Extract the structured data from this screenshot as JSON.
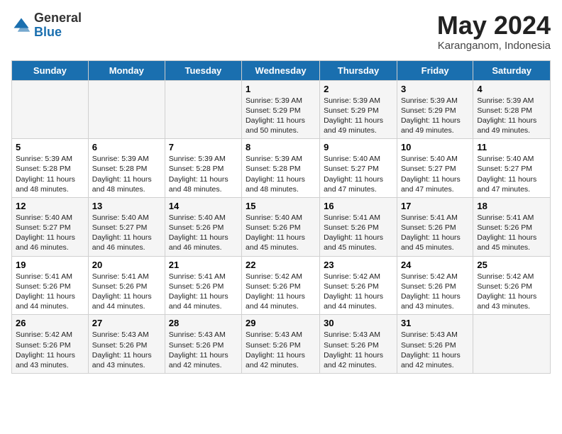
{
  "header": {
    "logo_general": "General",
    "logo_blue": "Blue",
    "title": "May 2024",
    "subtitle": "Karanganom, Indonesia"
  },
  "columns": [
    "Sunday",
    "Monday",
    "Tuesday",
    "Wednesday",
    "Thursday",
    "Friday",
    "Saturday"
  ],
  "rows": [
    [
      {
        "day": "",
        "info": ""
      },
      {
        "day": "",
        "info": ""
      },
      {
        "day": "",
        "info": ""
      },
      {
        "day": "1",
        "info": "Sunrise: 5:39 AM\nSunset: 5:29 PM\nDaylight: 11 hours and 50 minutes."
      },
      {
        "day": "2",
        "info": "Sunrise: 5:39 AM\nSunset: 5:29 PM\nDaylight: 11 hours and 49 minutes."
      },
      {
        "day": "3",
        "info": "Sunrise: 5:39 AM\nSunset: 5:29 PM\nDaylight: 11 hours and 49 minutes."
      },
      {
        "day": "4",
        "info": "Sunrise: 5:39 AM\nSunset: 5:28 PM\nDaylight: 11 hours and 49 minutes."
      }
    ],
    [
      {
        "day": "5",
        "info": "Sunrise: 5:39 AM\nSunset: 5:28 PM\nDaylight: 11 hours and 48 minutes."
      },
      {
        "day": "6",
        "info": "Sunrise: 5:39 AM\nSunset: 5:28 PM\nDaylight: 11 hours and 48 minutes."
      },
      {
        "day": "7",
        "info": "Sunrise: 5:39 AM\nSunset: 5:28 PM\nDaylight: 11 hours and 48 minutes."
      },
      {
        "day": "8",
        "info": "Sunrise: 5:39 AM\nSunset: 5:28 PM\nDaylight: 11 hours and 48 minutes."
      },
      {
        "day": "9",
        "info": "Sunrise: 5:40 AM\nSunset: 5:27 PM\nDaylight: 11 hours and 47 minutes."
      },
      {
        "day": "10",
        "info": "Sunrise: 5:40 AM\nSunset: 5:27 PM\nDaylight: 11 hours and 47 minutes."
      },
      {
        "day": "11",
        "info": "Sunrise: 5:40 AM\nSunset: 5:27 PM\nDaylight: 11 hours and 47 minutes."
      }
    ],
    [
      {
        "day": "12",
        "info": "Sunrise: 5:40 AM\nSunset: 5:27 PM\nDaylight: 11 hours and 46 minutes."
      },
      {
        "day": "13",
        "info": "Sunrise: 5:40 AM\nSunset: 5:27 PM\nDaylight: 11 hours and 46 minutes."
      },
      {
        "day": "14",
        "info": "Sunrise: 5:40 AM\nSunset: 5:26 PM\nDaylight: 11 hours and 46 minutes."
      },
      {
        "day": "15",
        "info": "Sunrise: 5:40 AM\nSunset: 5:26 PM\nDaylight: 11 hours and 45 minutes."
      },
      {
        "day": "16",
        "info": "Sunrise: 5:41 AM\nSunset: 5:26 PM\nDaylight: 11 hours and 45 minutes."
      },
      {
        "day": "17",
        "info": "Sunrise: 5:41 AM\nSunset: 5:26 PM\nDaylight: 11 hours and 45 minutes."
      },
      {
        "day": "18",
        "info": "Sunrise: 5:41 AM\nSunset: 5:26 PM\nDaylight: 11 hours and 45 minutes."
      }
    ],
    [
      {
        "day": "19",
        "info": "Sunrise: 5:41 AM\nSunset: 5:26 PM\nDaylight: 11 hours and 44 minutes."
      },
      {
        "day": "20",
        "info": "Sunrise: 5:41 AM\nSunset: 5:26 PM\nDaylight: 11 hours and 44 minutes."
      },
      {
        "day": "21",
        "info": "Sunrise: 5:41 AM\nSunset: 5:26 PM\nDaylight: 11 hours and 44 minutes."
      },
      {
        "day": "22",
        "info": "Sunrise: 5:42 AM\nSunset: 5:26 PM\nDaylight: 11 hours and 44 minutes."
      },
      {
        "day": "23",
        "info": "Sunrise: 5:42 AM\nSunset: 5:26 PM\nDaylight: 11 hours and 44 minutes."
      },
      {
        "day": "24",
        "info": "Sunrise: 5:42 AM\nSunset: 5:26 PM\nDaylight: 11 hours and 43 minutes."
      },
      {
        "day": "25",
        "info": "Sunrise: 5:42 AM\nSunset: 5:26 PM\nDaylight: 11 hours and 43 minutes."
      }
    ],
    [
      {
        "day": "26",
        "info": "Sunrise: 5:42 AM\nSunset: 5:26 PM\nDaylight: 11 hours and 43 minutes."
      },
      {
        "day": "27",
        "info": "Sunrise: 5:43 AM\nSunset: 5:26 PM\nDaylight: 11 hours and 43 minutes."
      },
      {
        "day": "28",
        "info": "Sunrise: 5:43 AM\nSunset: 5:26 PM\nDaylight: 11 hours and 42 minutes."
      },
      {
        "day": "29",
        "info": "Sunrise: 5:43 AM\nSunset: 5:26 PM\nDaylight: 11 hours and 42 minutes."
      },
      {
        "day": "30",
        "info": "Sunrise: 5:43 AM\nSunset: 5:26 PM\nDaylight: 11 hours and 42 minutes."
      },
      {
        "day": "31",
        "info": "Sunrise: 5:43 AM\nSunset: 5:26 PM\nDaylight: 11 hours and 42 minutes."
      },
      {
        "day": "",
        "info": ""
      }
    ]
  ]
}
